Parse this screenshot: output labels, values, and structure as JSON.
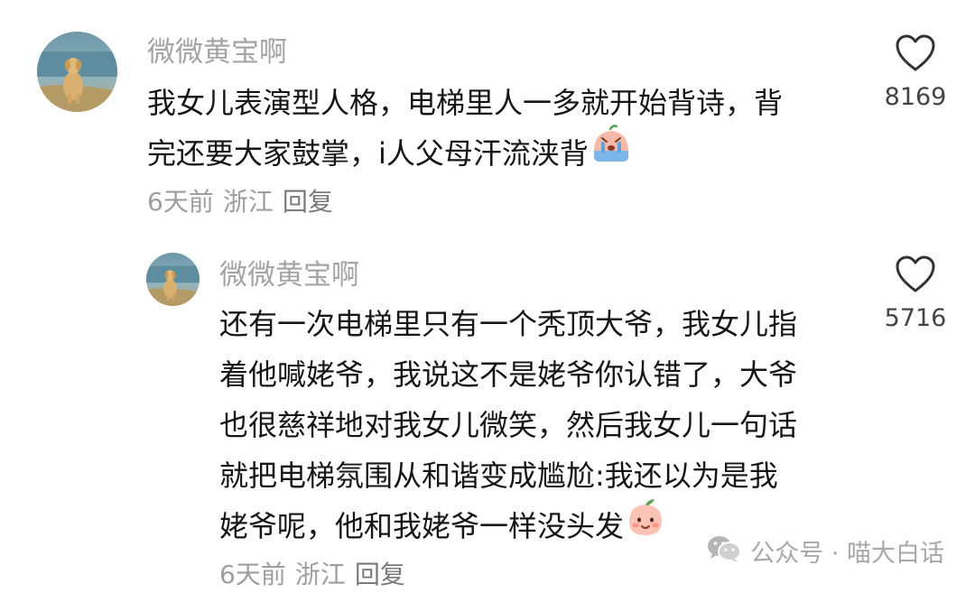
{
  "comments": [
    {
      "username": "微微黄宝啊",
      "lines": [
        "我女儿表演型人格，电梯里人一多就开始背诗，背",
        "完还要大家鼓掌，i人父母汗流浃背"
      ],
      "emoji": "crying-face",
      "time": "6天前",
      "location": "浙江",
      "reply_label": "回复",
      "likes": "8169"
    },
    {
      "username": "微微黄宝啊",
      "lines": [
        "还有一次电梯里只有一个秃顶大爷，我女儿指",
        "着他喊姥爷，我说这不是姥爷你认错了，大爷",
        "也很慈祥地对我女儿微笑，然后我女儿一句话",
        "就把电梯氛围从和谐变成尴尬:我还以为是我",
        "姥爷呢，他和我姥爷一样没头发"
      ],
      "emoji": "peach-face",
      "time": "6天前",
      "location": "浙江",
      "reply_label": "回复",
      "likes": "5716"
    }
  ],
  "watermark": {
    "icon": "wechat-icon",
    "text": "公众号 · 喵大白话"
  },
  "colors": {
    "username": "#a4a4a4",
    "text": "#161616",
    "meta": "#9e9e9e"
  }
}
